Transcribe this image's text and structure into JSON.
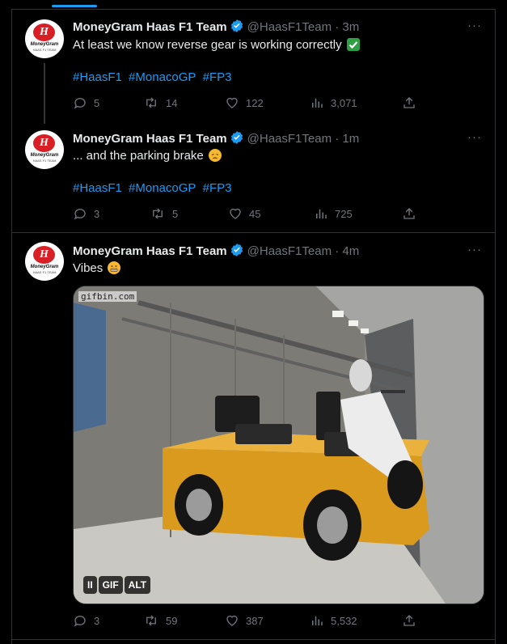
{
  "colors": {
    "accent": "#1d9bf0",
    "muted": "#71767b",
    "text": "#e7e9ea",
    "brand_red": "#d81f26"
  },
  "avatar": {
    "brand": "MoneyGram",
    "sub": "HAAS F1 TEAM"
  },
  "tweets": [
    {
      "author": "MoneyGram Haas F1 Team",
      "handle": "@HaasF1Team",
      "time": "· 3m",
      "text": "At least we know reverse gear is working correctly",
      "emoji": "check-mark-emoji",
      "hashtags": [
        "#HaasF1",
        "#MonacoGP",
        "#FP3"
      ],
      "replies": "5",
      "reposts": "14",
      "likes": "122",
      "views": "3,071"
    },
    {
      "author": "MoneyGram Haas F1 Team",
      "handle": "@HaasF1Team",
      "time": "· 1m",
      "text": "... and the parking brake",
      "emoji": "disappointed-face-emoji",
      "hashtags": [
        "#HaasF1",
        "#MonacoGP",
        "#FP3"
      ],
      "replies": "3",
      "reposts": "5",
      "likes": "45",
      "views": "725"
    },
    {
      "author": "MoneyGram Haas F1 Team",
      "handle": "@HaasF1Team",
      "time": "· 4m",
      "text": "Vibes",
      "emoji": "grimacing-face-emoji",
      "media": {
        "watermark": "gifbin.com",
        "pause_label": "II",
        "gif_label": "GIF",
        "alt_label": "ALT"
      },
      "replies": "3",
      "reposts": "59",
      "likes": "387",
      "views": "5,532"
    }
  ]
}
